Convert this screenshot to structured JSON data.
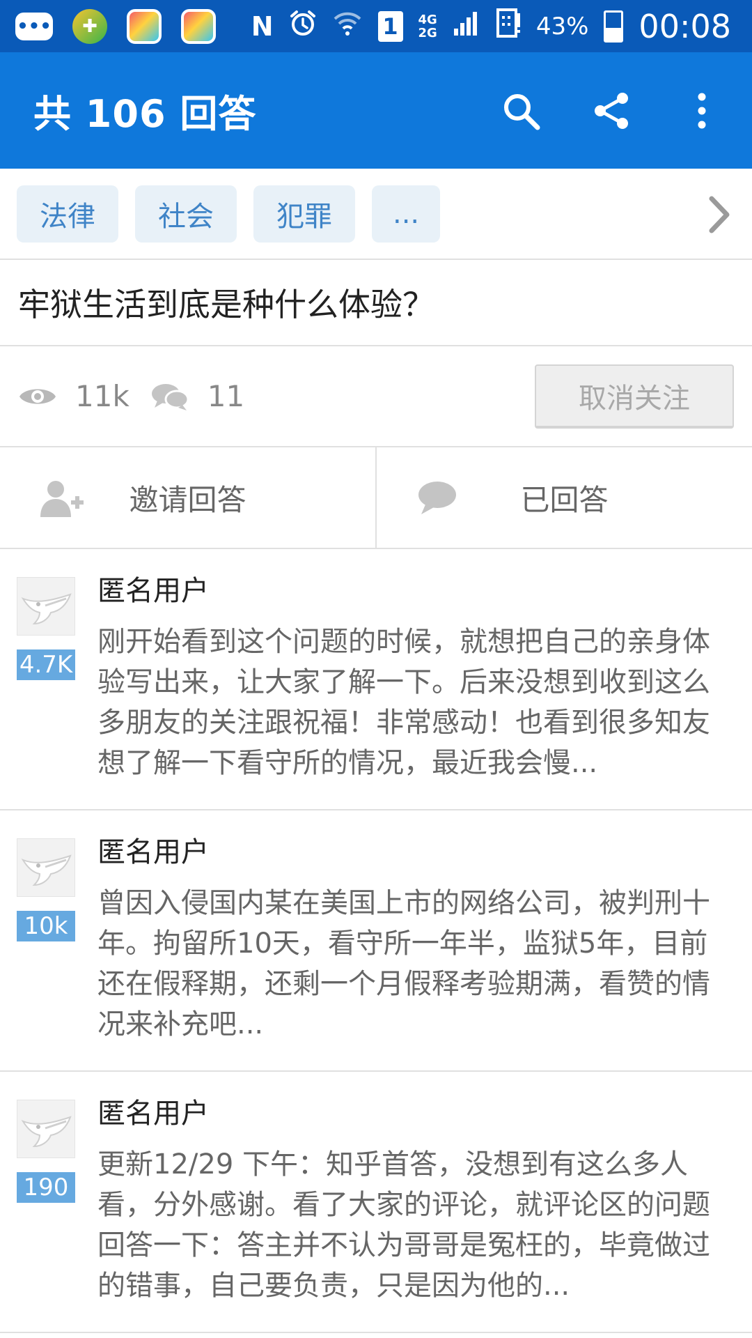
{
  "status_bar": {
    "app_icons": [
      "messages-icon",
      "game-icon",
      "app-icon",
      "app-icon"
    ],
    "nfc": "N",
    "sim_slot": "1",
    "network": {
      "top": "4G",
      "bottom": "2G"
    },
    "battery_percent": "43%",
    "battery_level": 0.43,
    "time": "00:08"
  },
  "app_bar": {
    "title": "共 106 回答",
    "actions": [
      "search-icon",
      "share-icon",
      "more-icon"
    ]
  },
  "tags": [
    "法律",
    "社会",
    "犯罪",
    "..."
  ],
  "question": {
    "title": "牢狱生活到底是种什么体验？",
    "views": "11k",
    "comments": "11",
    "unfollow_label": "取消关注"
  },
  "actions": {
    "invite_label": "邀请回答",
    "answered_label": "已回答"
  },
  "answers": [
    {
      "author": "匿名用户",
      "votes": "4.7K",
      "excerpt": "刚开始看到这个问题的时候，就想把自己的亲身体验写出来，让大家了解一下。后来没想到收到这么多朋友的关注跟祝福！非常感动！也看到很多知友想了解一下看守所的情况，最近我会慢..."
    },
    {
      "author": "匿名用户",
      "votes": "10k",
      "excerpt": "曾因入侵国内某在美国上市的网络公司，被判刑十年。拘留所10天，看守所一年半，监狱5年，目前还在假释期，还剩一个月假释考验期满，看赞的情况来补充吧..."
    },
    {
      "author": "匿名用户",
      "votes": "190",
      "excerpt": "更新12/29 下午：知乎首答，没想到有这么多人看，分外感谢。看了大家的评论，就评论区的问题回答一下：答主并不认为哥哥是冤枉的，毕竟做过的错事，自己要负责，只是因为他的..."
    }
  ],
  "colors": {
    "status_bar": "#0a5ab8",
    "app_bar": "#0f78db",
    "tag_bg": "#e8f1f8",
    "tag_text": "#3f84c7",
    "vote_badge": "#66a9e0"
  }
}
